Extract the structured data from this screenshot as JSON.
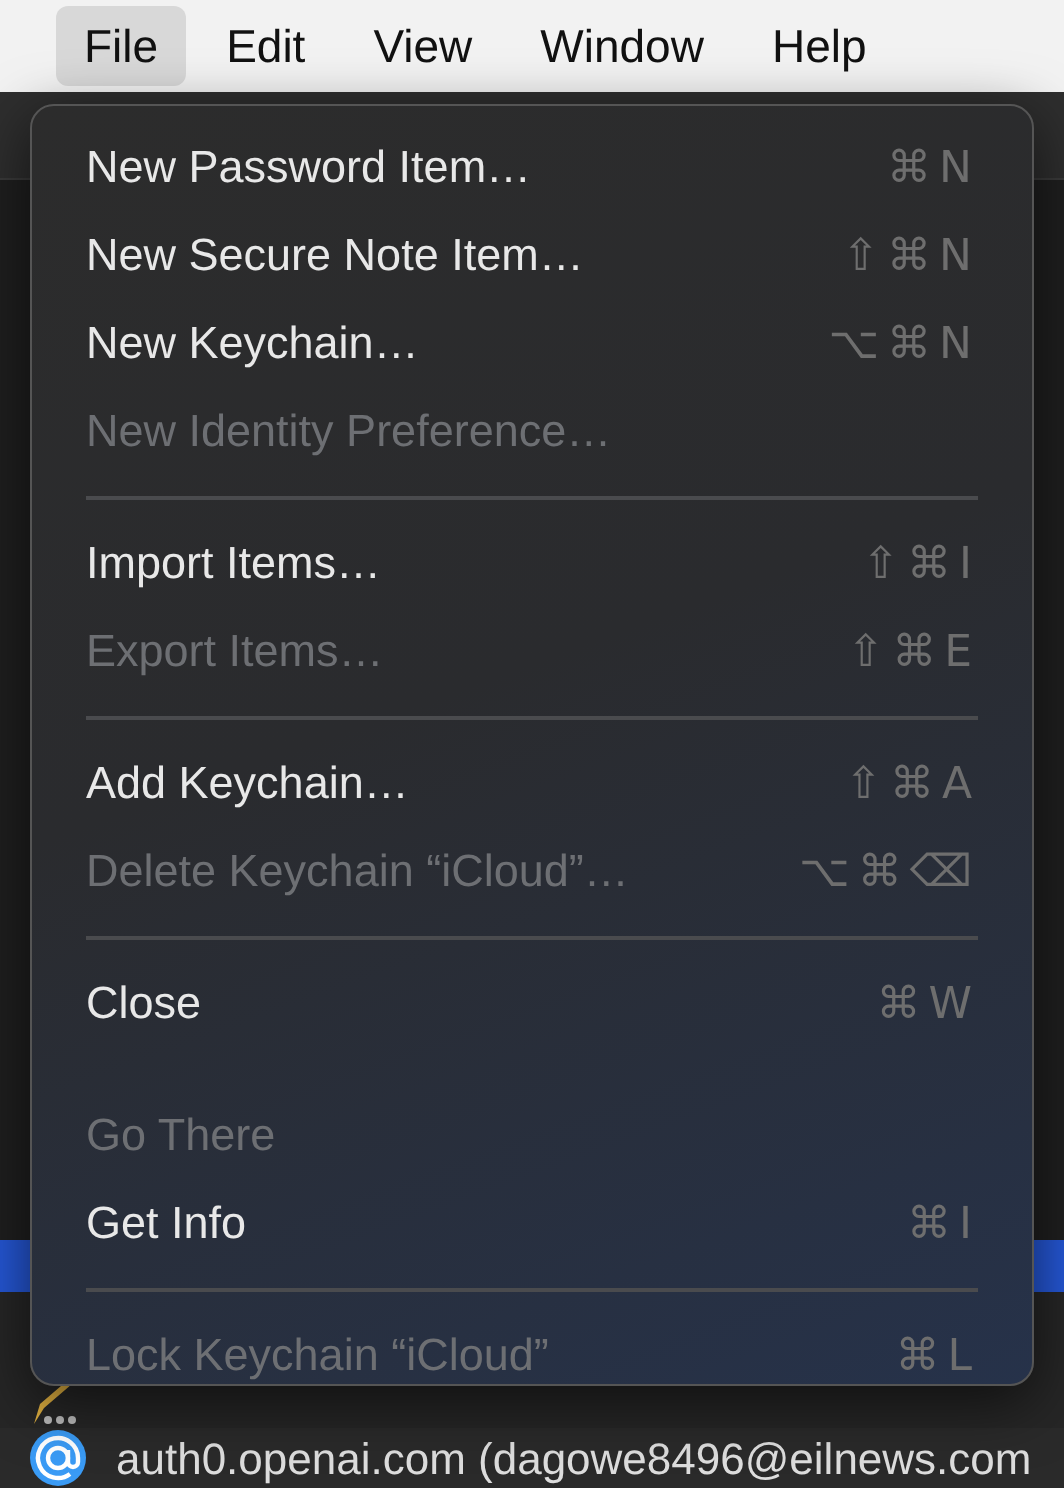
{
  "menubar": [
    {
      "label": "File",
      "selected": true
    },
    {
      "label": "Edit",
      "selected": false
    },
    {
      "label": "View",
      "selected": false
    },
    {
      "label": "Window",
      "selected": false
    },
    {
      "label": "Help",
      "selected": false
    }
  ],
  "menu": {
    "items": [
      {
        "kind": "item",
        "label": "New Password Item…",
        "shortcut": "⌘N",
        "disabled": false
      },
      {
        "kind": "item",
        "label": "New Secure Note Item…",
        "shortcut": "⇧⌘N",
        "disabled": false
      },
      {
        "kind": "item",
        "label": "New Keychain…",
        "shortcut": "⌥⌘N",
        "disabled": false
      },
      {
        "kind": "item",
        "label": "New Identity Preference…",
        "disabled": true
      },
      {
        "kind": "separator"
      },
      {
        "kind": "item",
        "label": "Import Items…",
        "shortcut": "⇧⌘I",
        "disabled": false
      },
      {
        "kind": "item",
        "label": "Export Items…",
        "shortcut": "⇧⌘E",
        "disabled": true
      },
      {
        "kind": "separator"
      },
      {
        "kind": "item",
        "label": "Add Keychain…",
        "shortcut": "⇧⌘A",
        "disabled": false
      },
      {
        "kind": "item",
        "label": "Delete Keychain “iCloud”…",
        "shortcut": "⌥⌘⌫",
        "disabled": true
      },
      {
        "kind": "separator"
      },
      {
        "kind": "item",
        "label": "Close",
        "shortcut": "⌘W",
        "disabled": false
      },
      {
        "kind": "spacer"
      },
      {
        "kind": "item",
        "label": "Go There",
        "disabled": true
      },
      {
        "kind": "item",
        "label": "Get Info",
        "shortcut": "⌘I",
        "disabled": false
      },
      {
        "kind": "separator"
      },
      {
        "kind": "item",
        "label": "Lock Keychain “iCloud”",
        "shortcut": "⌘L",
        "disabled": true
      }
    ]
  },
  "list_rows": [
    {
      "kind": "note"
    },
    {
      "kind": "web",
      "label": "auth0.openai.com (dagowe8496@eilnews.com"
    }
  ]
}
